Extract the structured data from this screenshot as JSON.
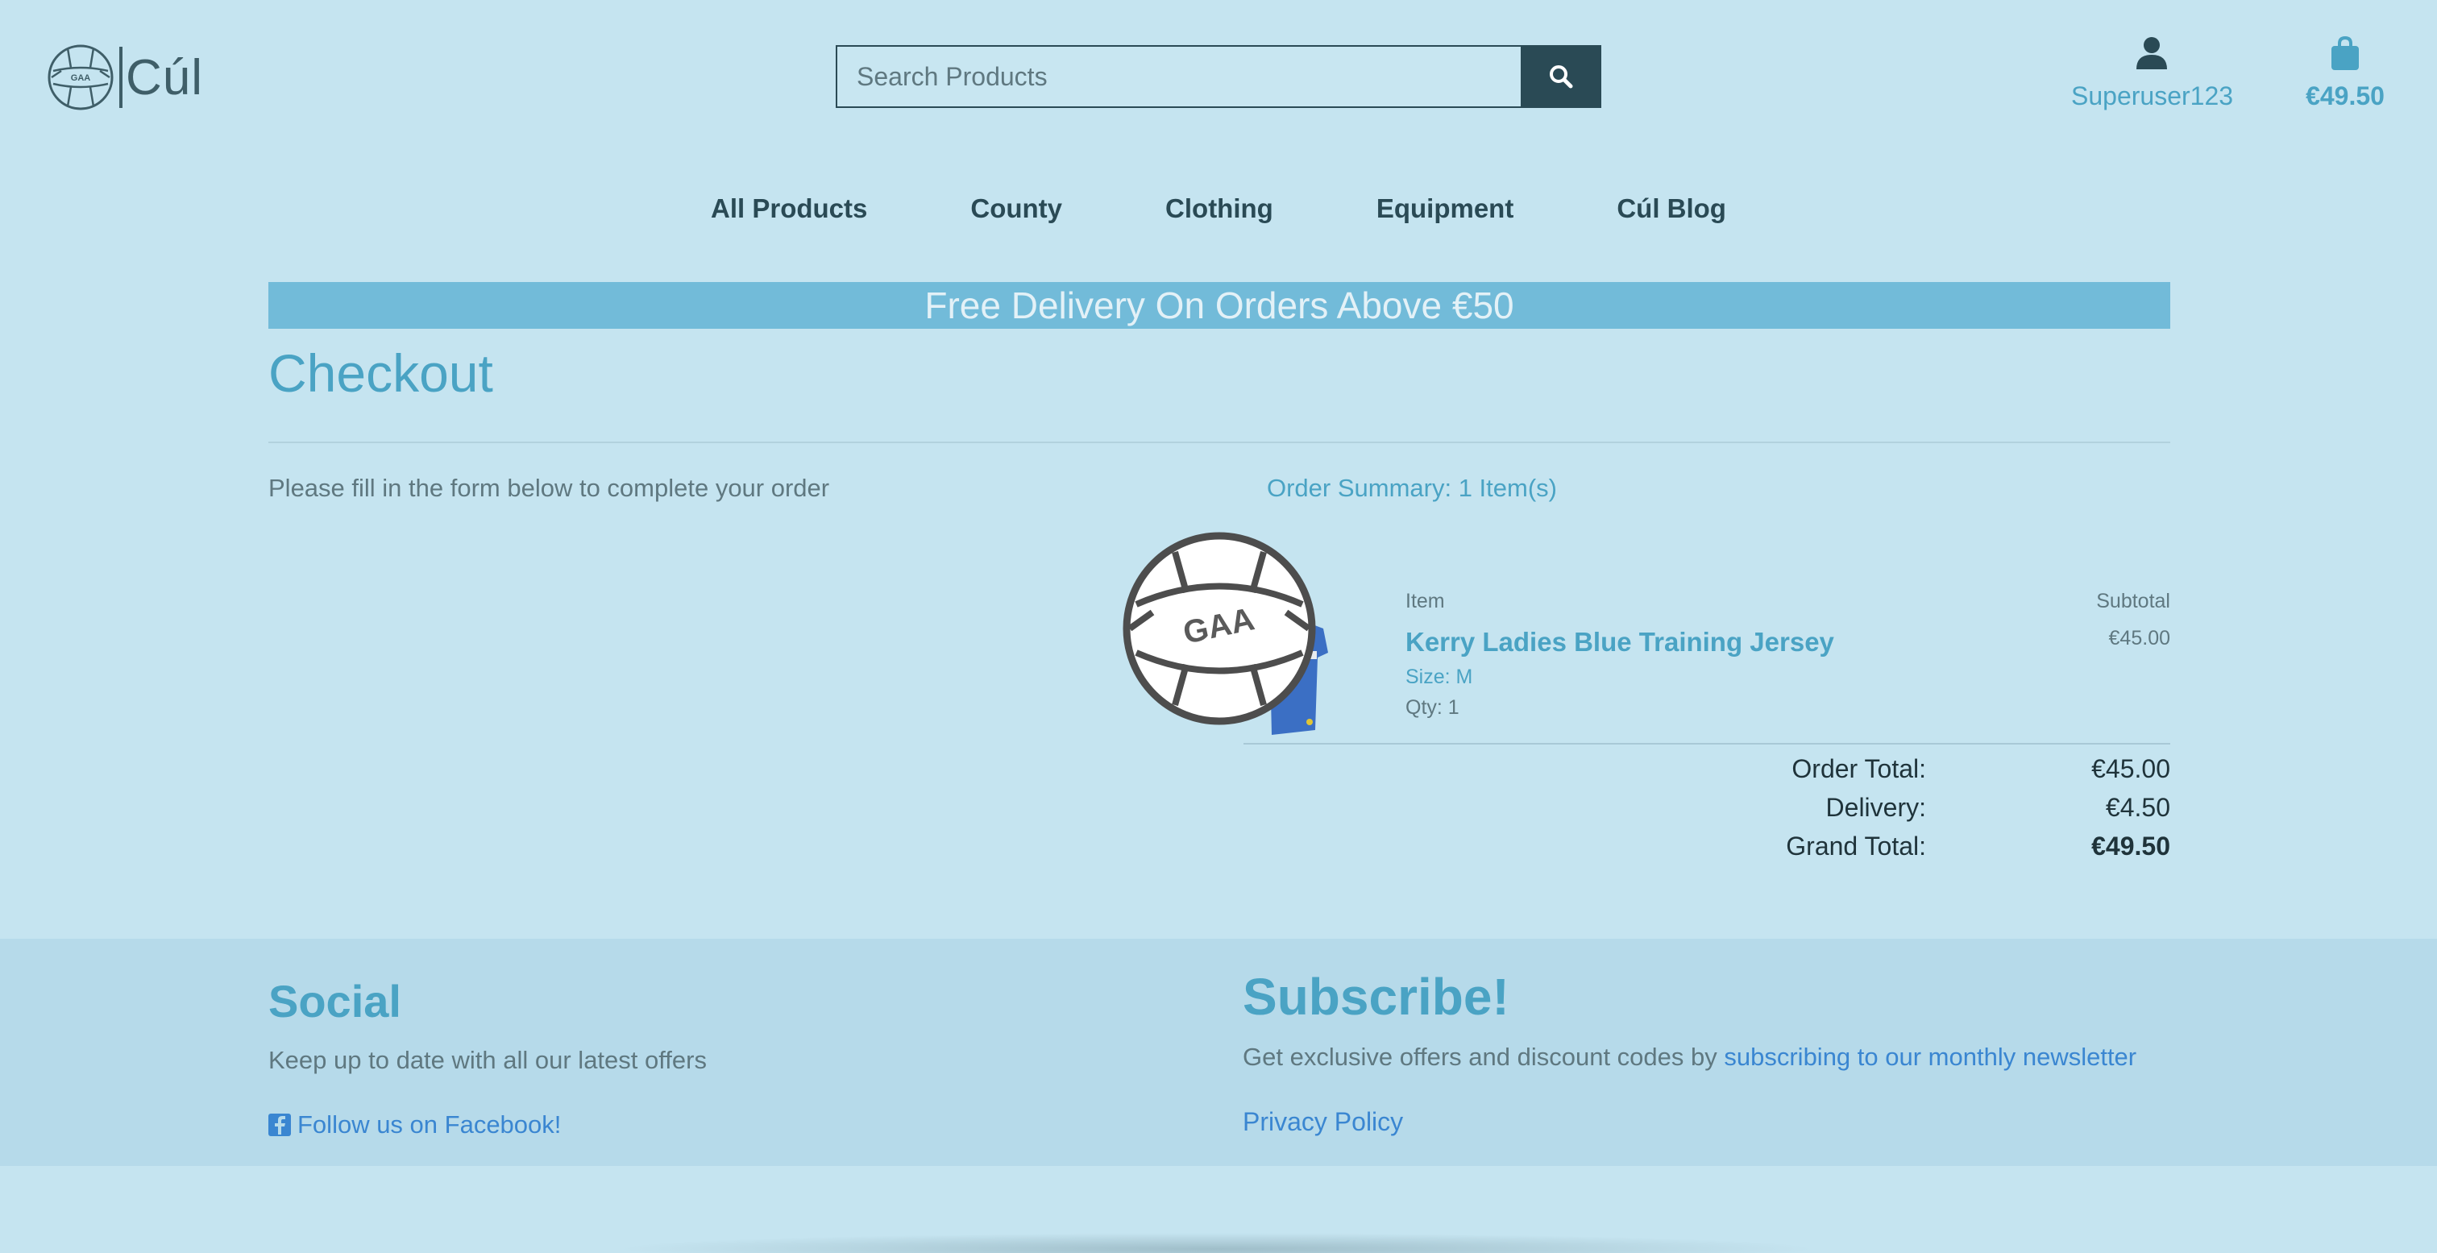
{
  "brand": {
    "name": "Cúl"
  },
  "search": {
    "placeholder": "Search Products"
  },
  "account": {
    "username": "Superuser123"
  },
  "cart": {
    "total": "€49.50"
  },
  "nav": [
    {
      "label": "All Products"
    },
    {
      "label": "County"
    },
    {
      "label": "Clothing"
    },
    {
      "label": "Equipment"
    },
    {
      "label": "Cúl Blog"
    }
  ],
  "banner": {
    "text": "Free Delivery On Orders Above €50"
  },
  "checkout": {
    "title": "Checkout",
    "form_hint": "Please fill in the form below to complete your order",
    "summary_title": "Order Summary: 1 Item(s)",
    "columns": {
      "item": "Item",
      "subtotal": "Subtotal"
    },
    "items": [
      {
        "name": "Kerry Ladies Blue Training Jersey",
        "size": "Size: M",
        "qty": "Qty: 1",
        "subtotal": "€45.00"
      }
    ],
    "totals": {
      "order_label": "Order Total:",
      "order_value": "€45.00",
      "delivery_label": "Delivery:",
      "delivery_value": "€4.50",
      "grand_label": "Grand Total:",
      "grand_value": "€49.50"
    }
  },
  "footer": {
    "social_title": "Social",
    "social_text": "Keep up to date with all our latest offers",
    "facebook_label": "Follow us on Facebook!",
    "subscribe_title": "Subscribe!",
    "subscribe_text": "Get exclusive offers and discount codes by ",
    "subscribe_link": "subscribing to our monthly newsletter",
    "privacy_label": "Privacy Policy"
  },
  "colors": {
    "background": "#c5e4f0",
    "accent": "#4aa3c4",
    "dark": "#2a4a55",
    "link": "#3a86d1",
    "banner": "#72bbd9"
  }
}
